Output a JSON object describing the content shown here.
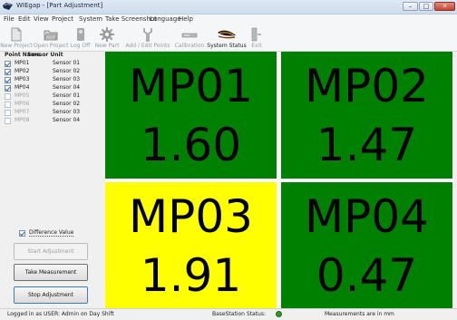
{
  "window": {
    "title": "WIEgap - [Part Adjustment]",
    "controls": {
      "minimize": "–",
      "maximize": "□",
      "close": "✕"
    }
  },
  "menu": [
    "File",
    "Edit",
    "View",
    "Project",
    "System",
    "Take Screenshot",
    "Language",
    "Help"
  ],
  "toolbar": [
    {
      "label": "New Project",
      "icon": "new-document-icon",
      "enabled": false
    },
    {
      "label": "Open Project",
      "icon": "open-folder-icon",
      "enabled": false
    },
    {
      "label": "Log Off",
      "icon": "user-logoff-icon",
      "enabled": false
    },
    {
      "label": "New Part",
      "icon": "gear-icon",
      "enabled": false
    },
    {
      "label": "Add / Edit Points",
      "icon": "probe-icon",
      "enabled": false
    },
    {
      "label": "Calibration",
      "icon": "calibration-bar-icon",
      "enabled": false
    },
    {
      "label": "System Status",
      "icon": "feather-status-icon",
      "enabled": true
    },
    {
      "label": "Exit",
      "icon": "exit-door-icon",
      "enabled": false
    }
  ],
  "points_table": {
    "headers": {
      "name": "Point Name",
      "unit": "Sensor Unit"
    },
    "rows": [
      {
        "name": "MP01",
        "unit": "Sensor 01",
        "checked": true,
        "enabled": true
      },
      {
        "name": "MP02",
        "unit": "Sensor 02",
        "checked": true,
        "enabled": true
      },
      {
        "name": "MP03",
        "unit": "Sensor 03",
        "checked": true,
        "enabled": true
      },
      {
        "name": "MP04",
        "unit": "Sensor 04",
        "checked": true,
        "enabled": true
      },
      {
        "name": "MP05",
        "unit": "Sensor 01",
        "checked": false,
        "enabled": false
      },
      {
        "name": "MP06",
        "unit": "Sensor 02",
        "checked": false,
        "enabled": false
      },
      {
        "name": "MP07",
        "unit": "Sensor 03",
        "checked": false,
        "enabled": false
      },
      {
        "name": "MP08",
        "unit": "Sensor 04",
        "checked": false,
        "enabled": false
      }
    ]
  },
  "difference_value": {
    "label": "Difference Value",
    "checked": true
  },
  "buttons": {
    "start": "Start Adjustment",
    "take": "Take Measurement",
    "stop": "Stop Adjustment"
  },
  "tiles": [
    {
      "name": "MP01",
      "value": "1.60",
      "color": "#008000"
    },
    {
      "name": "MP02",
      "value": "1.47",
      "color": "#008000"
    },
    {
      "name": "MP03",
      "value": "1.91",
      "color": "#ffff00"
    },
    {
      "name": "MP04",
      "value": "0.47",
      "color": "#008000"
    }
  ],
  "status": {
    "user": "Logged in as USER: Admin on Day Shift",
    "basestation": "BaseStation Status:",
    "basestation_color": "#2f9b1c",
    "units": "Measurements are in mm"
  }
}
